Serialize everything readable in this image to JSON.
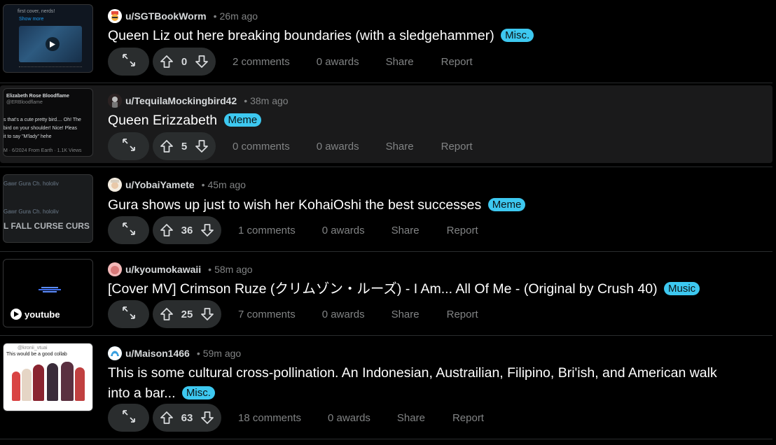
{
  "posts": [
    {
      "username": "u/SGTBookWorm",
      "time": "26m ago",
      "title": "Queen Liz out here breaking boundaries (with a sledgehammer)",
      "flair": "Misc.",
      "score": "0",
      "comments": "2 comments",
      "awards": "0 awards",
      "share": "Share",
      "report": "Report",
      "thumb_text": [
        "first cover, nerds!",
        "Show more"
      ]
    },
    {
      "username": "u/TequilaMockingbird42",
      "time": "38m ago",
      "title": "Queen Erizzabeth",
      "flair": "Meme",
      "score": "5",
      "comments": "0 comments",
      "awards": "0 awards",
      "share": "Share",
      "report": "Report",
      "thumb_text": [
        "Elizabeth Rose Bloodflame",
        "@ERBloodflame",
        "s that's a cute pretty bird.... Oh! The",
        "bird on your shoulder! Nice! Pleas",
        "it to say \"M'lady\" hehe",
        "M · 6/2024 From Earth · 1.1K Views"
      ]
    },
    {
      "username": "u/YobaiYamete",
      "time": "45m ago",
      "title": "Gura shows up just to wish her KohaiOshi the best successes",
      "flair": "Meme",
      "score": "36",
      "comments": "1 comments",
      "awards": "0 awards",
      "share": "Share",
      "report": "Report",
      "thumb_text": [
        "Gawr Gura Ch. hololiv",
        "Gawr Gura Ch. hololiv",
        "L FALL CURSE CURS"
      ]
    },
    {
      "username": "u/kyoumokawaii",
      "time": "58m ago",
      "title": "[Cover MV] Crimson Ruze (クリムゾン・ルーズ) - I Am... All Of Me - (Original by Crush 40)",
      "flair": "Music",
      "score": "25",
      "comments": "7 comments",
      "awards": "0 awards",
      "share": "Share",
      "report": "Report",
      "thumb_text": [
        "youtube"
      ]
    },
    {
      "username": "u/Maison1466",
      "time": "59m ago",
      "title_line1": "This is some cultural cross-pollination. An Indonesian, Austrailian, Filipino, Bri'ish, and American walk",
      "title_line2": "into a bar...",
      "flair": "Misc.",
      "score": "63",
      "comments": "18 comments",
      "awards": "0 awards",
      "share": "Share",
      "report": "Report",
      "thumb_text": [
        "@kronii_vtuai",
        "This would be a good collab"
      ]
    }
  ],
  "colors": {
    "background": "#000000",
    "hover_row": "#1a1a1b",
    "button_bg": "#2a2d2e",
    "flair_bg": "#3dc8f0",
    "muted_text": "#818384"
  },
  "icons": [
    "expand-icon",
    "upvote-icon",
    "downvote-icon",
    "play-icon",
    "youtube-icon"
  ]
}
